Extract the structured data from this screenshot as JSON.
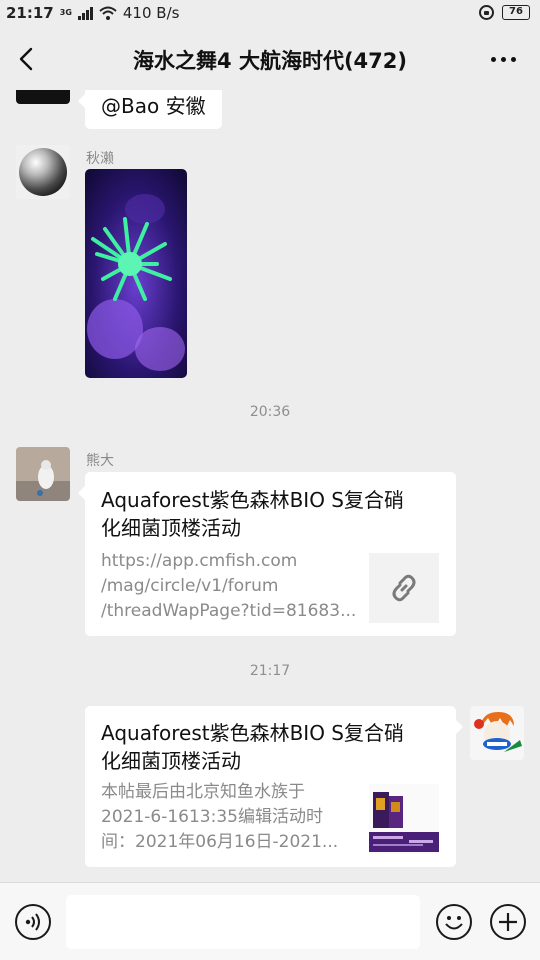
{
  "status_bar": {
    "time": "21:17",
    "network_type": "3G",
    "speed": "410 B/s",
    "battery": "76"
  },
  "header": {
    "title": "海水之舞4 大航海时代(472)"
  },
  "messages": {
    "m1": {
      "text": "@Bao  安徽"
    },
    "m2": {
      "sender": "秋濑"
    },
    "time1": "20:36",
    "m3": {
      "sender": "熊大",
      "title_line1": "Aquaforest紫色森林BIO S复合硝",
      "title_line2": "化细菌顶楼活动",
      "desc_line1": "https://app.cmfish.com",
      "desc_line2": "/mag/circle/v1/forum",
      "desc_line3": "/threadWapPage?tid=81683..."
    },
    "time2": "21:17",
    "m4": {
      "title_line1": "Aquaforest紫色森林BIO S复合硝",
      "title_line2": "化细菌顶楼活动",
      "desc_line1": "本帖最后由北京知鱼水族于",
      "desc_line2": "2021-6-1613:35编辑活动时",
      "desc_line3": "间：2021年06月16日-2021..."
    }
  },
  "input": {
    "placeholder": ""
  },
  "icons": [
    "back-icon",
    "more-icon",
    "link-icon",
    "voice-icon",
    "emoji-icon",
    "plus-icon"
  ],
  "colors": {
    "background": "#ededed",
    "bubble": "#ffffff",
    "secondary_text": "#8a8a8a"
  }
}
